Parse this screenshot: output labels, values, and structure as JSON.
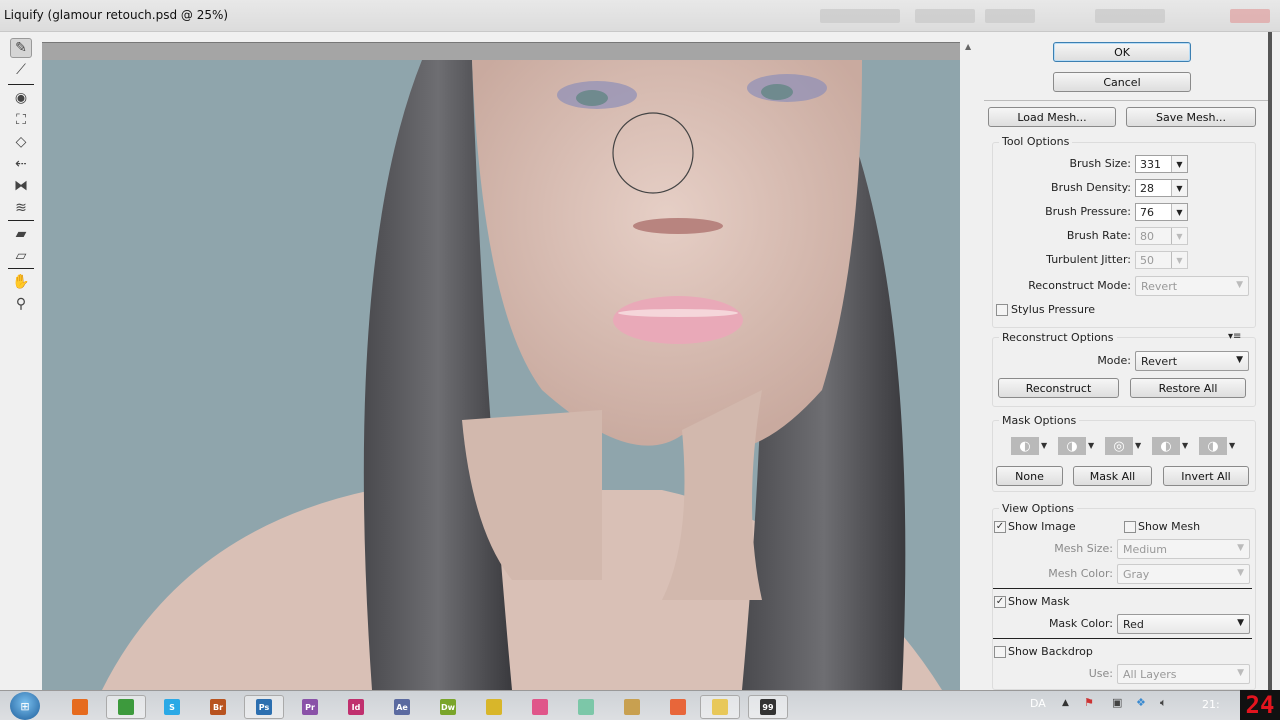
{
  "window": {
    "title": "Liquify (glamour retouch.psd @ 25%)"
  },
  "tools": [
    "forward-warp-tool",
    "reconstruct-tool",
    "twirl-clockwise-tool",
    "pucker-tool",
    "bloat-tool",
    "push-left-tool",
    "mirror-tool",
    "turbulence-tool",
    "freeze-mask-tool",
    "thaw-mask-tool",
    "hand-tool",
    "zoom-tool"
  ],
  "buttons": {
    "ok": "OK",
    "cancel": "Cancel",
    "load_mesh": "Load Mesh...",
    "save_mesh": "Save Mesh..."
  },
  "tool_options": {
    "title": "Tool Options",
    "brush_size": {
      "label": "Brush Size:",
      "value": "331"
    },
    "brush_density": {
      "label": "Brush Density:",
      "value": "28"
    },
    "brush_pressure": {
      "label": "Brush Pressure:",
      "value": "76"
    },
    "brush_rate": {
      "label": "Brush Rate:",
      "value": "80"
    },
    "turbulent_jitter": {
      "label": "Turbulent Jitter:",
      "value": "50"
    },
    "reconstruct_mode": {
      "label": "Reconstruct Mode:",
      "value": "Revert"
    },
    "stylus_pressure": {
      "label": "Stylus Pressure",
      "checked": false
    }
  },
  "reconstruct_options": {
    "title": "Reconstruct Options",
    "mode_label": "Mode:",
    "mode_value": "Revert",
    "reconstruct": "Reconstruct",
    "restore_all": "Restore All"
  },
  "mask_options": {
    "title": "Mask Options",
    "none": "None",
    "mask_all": "Mask All",
    "invert_all": "Invert All"
  },
  "view_options": {
    "title": "View Options",
    "show_image": {
      "label": "Show Image",
      "checked": true
    },
    "show_mesh": {
      "label": "Show Mesh",
      "checked": false
    },
    "mesh_size": {
      "label": "Mesh Size:",
      "value": "Medium"
    },
    "mesh_color": {
      "label": "Mesh Color:",
      "value": "Gray"
    },
    "show_mask": {
      "label": "Show Mask",
      "checked": true
    },
    "mask_color": {
      "label": "Mask Color:",
      "value": "Red"
    },
    "show_backdrop": {
      "label": "Show Backdrop",
      "checked": false
    },
    "use": {
      "label": "Use:",
      "value": "All Layers"
    }
  },
  "taskbar": {
    "apps": [
      {
        "name": "firefox",
        "label": "",
        "color": "#e66b1e"
      },
      {
        "name": "chrome",
        "label": "",
        "color": "#3d9a3d"
      },
      {
        "name": "skype",
        "label": "S",
        "color": "#2aa9e6"
      },
      {
        "name": "bridge",
        "label": "Br",
        "color": "#b8531f"
      },
      {
        "name": "photoshop",
        "label": "Ps",
        "color": "#2c6fb0"
      },
      {
        "name": "premiere",
        "label": "Pr",
        "color": "#8a52a8"
      },
      {
        "name": "indesign",
        "label": "Id",
        "color": "#c0306e"
      },
      {
        "name": "after-effects",
        "label": "Ae",
        "color": "#5b6aa0"
      },
      {
        "name": "dreamweaver",
        "label": "Dw",
        "color": "#7aa52a"
      },
      {
        "name": "app-yellow",
        "label": "",
        "color": "#d8b62a"
      },
      {
        "name": "app-pink",
        "label": "",
        "color": "#e0568a"
      },
      {
        "name": "app-green",
        "label": "",
        "color": "#7cc7a8"
      },
      {
        "name": "app-feather",
        "label": "",
        "color": "#c8a050"
      },
      {
        "name": "app-orange",
        "label": "",
        "color": "#e8663a"
      },
      {
        "name": "explorer",
        "label": "",
        "color": "#e8c85a"
      },
      {
        "name": "app-monitor",
        "label": "99",
        "color": "#333"
      }
    ],
    "language": "DA",
    "clock": "21:",
    "badge": "24"
  }
}
